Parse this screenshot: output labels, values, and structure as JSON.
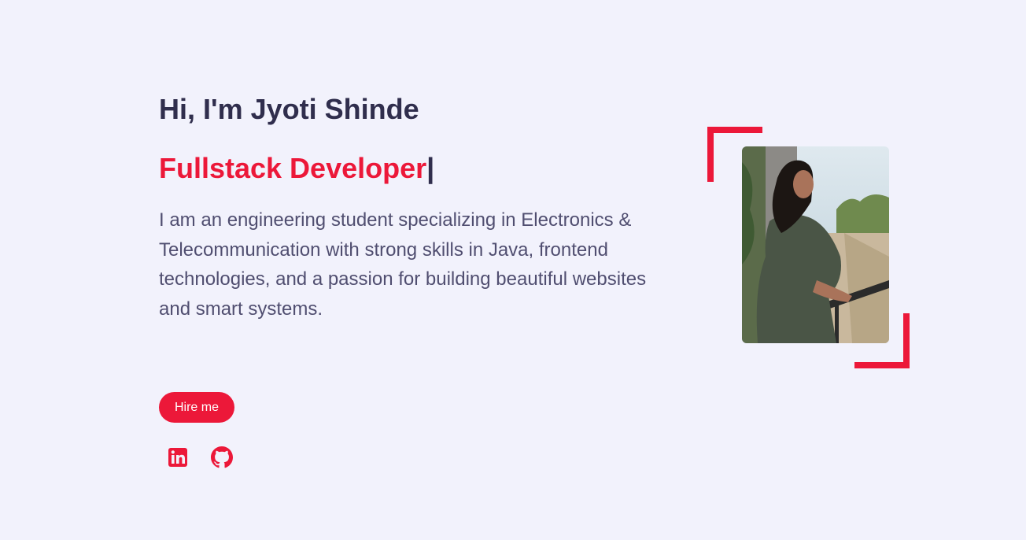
{
  "hero": {
    "greeting": "Hi, I'm Jyoti Shinde",
    "role": "Fullstack Developer",
    "cursor": "|",
    "bio": "I am an engineering student specializing in Electronics & Telecommunication with strong skills in Java, frontend technologies, and a passion for building beautiful websites and smart systems.",
    "hire_label": "Hire me"
  },
  "social": {
    "linkedin_icon": "linkedin-icon",
    "github_icon": "github-icon"
  },
  "colors": {
    "accent": "#ec1839",
    "heading": "#302e4d",
    "body_text": "#504e70",
    "background": "#f2f2fc"
  }
}
